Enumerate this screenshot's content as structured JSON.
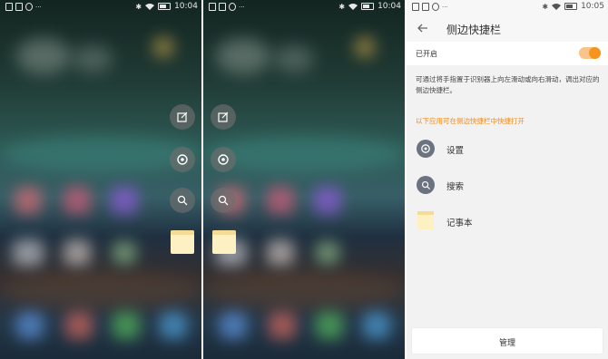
{
  "screens": [
    {
      "status_time": "10:04"
    },
    {
      "status_time": "10:04"
    },
    {
      "status_time": "10:05"
    }
  ],
  "sidebar_screen": {
    "title": "侧边快捷栏",
    "enabled_label": "已开启",
    "enabled": true,
    "description": "可通过将手指置于识别器上向左滑动或向右滑动，调出对应的侧边快捷栏。",
    "hint": "以下应用可在侧边快捷栏中快捷打开",
    "items": [
      {
        "label": "设置",
        "icon": "settings-icon"
      },
      {
        "label": "搜索",
        "icon": "search-icon"
      },
      {
        "label": "记事本",
        "icon": "notepad-icon"
      }
    ],
    "manage_label": "管理"
  },
  "side_dock_icons": [
    "edit-icon",
    "settings-icon",
    "search-icon",
    "notepad-icon"
  ],
  "colors": {
    "accent": "#f7941d",
    "hint": "#f08a1a"
  }
}
